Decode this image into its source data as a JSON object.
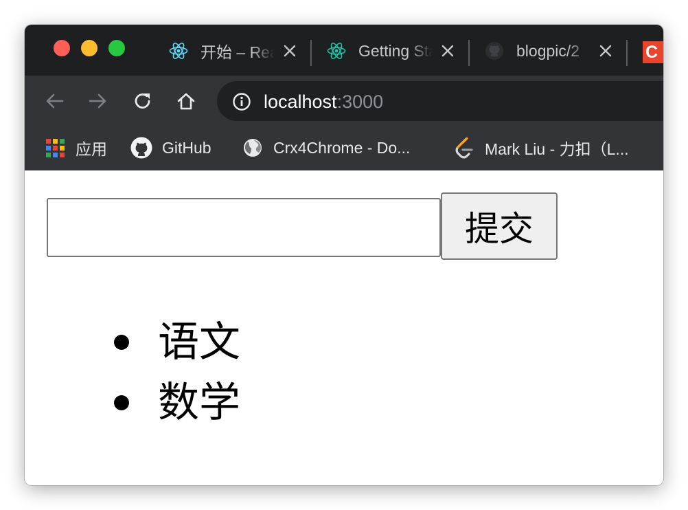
{
  "tabs": [
    {
      "title": "开始 – React",
      "icon": "react-icon"
    },
    {
      "title": "Getting Started",
      "icon": "react-icon"
    },
    {
      "title": "blogpic/2",
      "icon": "github-icon"
    }
  ],
  "tab_partial_letter": "C",
  "toolbar": {
    "url_host": "localhost",
    "url_port": ":3000"
  },
  "bookmarks": [
    {
      "label": "应用",
      "icon": "apps-grid-icon"
    },
    {
      "label": "GitHub",
      "icon": "github-icon"
    },
    {
      "label": "Crx4Chrome - Do...",
      "icon": "globe-icon"
    },
    {
      "label": "Mark Liu - 力扣（L...",
      "icon": "leetcode-icon"
    }
  ],
  "form": {
    "input_value": "",
    "submit_label": "提交"
  },
  "todos": [
    "语文",
    "数学"
  ],
  "colors": {
    "tab_strip": "#1e1f21",
    "toolbar": "#323438",
    "omnibox": "#1f2023",
    "react_blue": "#61dafb",
    "react_teal": "#1fc5a6",
    "leetcode_orange": "#ffa116"
  }
}
